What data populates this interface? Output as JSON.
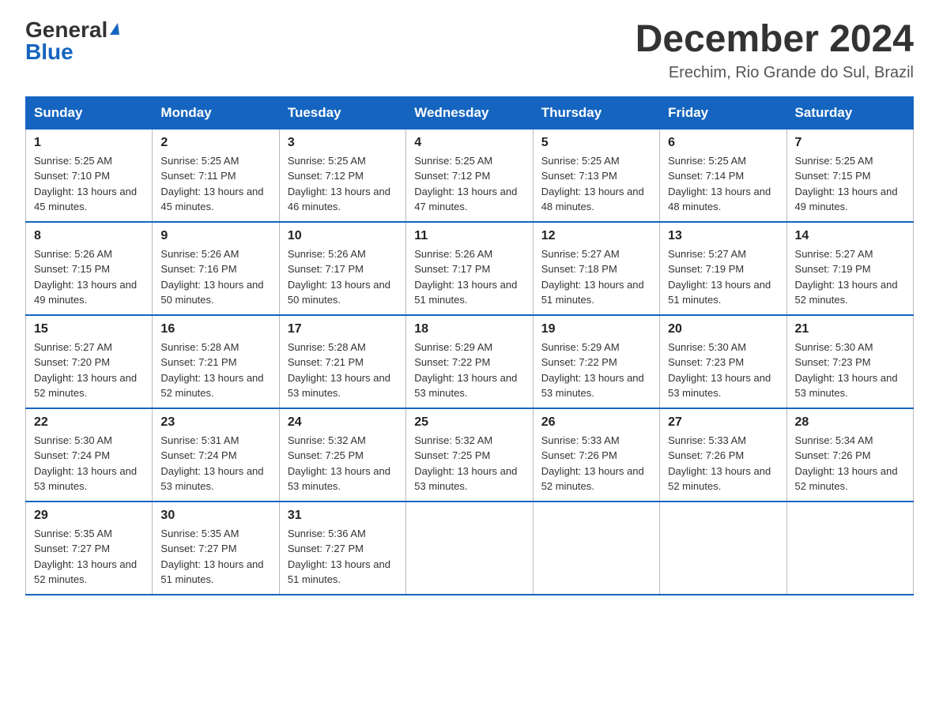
{
  "header": {
    "logo": {
      "general": "General",
      "blue": "Blue",
      "triangle": "▲"
    },
    "title": "December 2024",
    "location": "Erechim, Rio Grande do Sul, Brazil"
  },
  "calendar": {
    "days_of_week": [
      "Sunday",
      "Monday",
      "Tuesday",
      "Wednesday",
      "Thursday",
      "Friday",
      "Saturday"
    ],
    "weeks": [
      [
        {
          "day": "1",
          "sunrise": "5:25 AM",
          "sunset": "7:10 PM",
          "daylight": "13 hours and 45 minutes."
        },
        {
          "day": "2",
          "sunrise": "5:25 AM",
          "sunset": "7:11 PM",
          "daylight": "13 hours and 45 minutes."
        },
        {
          "day": "3",
          "sunrise": "5:25 AM",
          "sunset": "7:12 PM",
          "daylight": "13 hours and 46 minutes."
        },
        {
          "day": "4",
          "sunrise": "5:25 AM",
          "sunset": "7:12 PM",
          "daylight": "13 hours and 47 minutes."
        },
        {
          "day": "5",
          "sunrise": "5:25 AM",
          "sunset": "7:13 PM",
          "daylight": "13 hours and 48 minutes."
        },
        {
          "day": "6",
          "sunrise": "5:25 AM",
          "sunset": "7:14 PM",
          "daylight": "13 hours and 48 minutes."
        },
        {
          "day": "7",
          "sunrise": "5:25 AM",
          "sunset": "7:15 PM",
          "daylight": "13 hours and 49 minutes."
        }
      ],
      [
        {
          "day": "8",
          "sunrise": "5:26 AM",
          "sunset": "7:15 PM",
          "daylight": "13 hours and 49 minutes."
        },
        {
          "day": "9",
          "sunrise": "5:26 AM",
          "sunset": "7:16 PM",
          "daylight": "13 hours and 50 minutes."
        },
        {
          "day": "10",
          "sunrise": "5:26 AM",
          "sunset": "7:17 PM",
          "daylight": "13 hours and 50 minutes."
        },
        {
          "day": "11",
          "sunrise": "5:26 AM",
          "sunset": "7:17 PM",
          "daylight": "13 hours and 51 minutes."
        },
        {
          "day": "12",
          "sunrise": "5:27 AM",
          "sunset": "7:18 PM",
          "daylight": "13 hours and 51 minutes."
        },
        {
          "day": "13",
          "sunrise": "5:27 AM",
          "sunset": "7:19 PM",
          "daylight": "13 hours and 51 minutes."
        },
        {
          "day": "14",
          "sunrise": "5:27 AM",
          "sunset": "7:19 PM",
          "daylight": "13 hours and 52 minutes."
        }
      ],
      [
        {
          "day": "15",
          "sunrise": "5:27 AM",
          "sunset": "7:20 PM",
          "daylight": "13 hours and 52 minutes."
        },
        {
          "day": "16",
          "sunrise": "5:28 AM",
          "sunset": "7:21 PM",
          "daylight": "13 hours and 52 minutes."
        },
        {
          "day": "17",
          "sunrise": "5:28 AM",
          "sunset": "7:21 PM",
          "daylight": "13 hours and 53 minutes."
        },
        {
          "day": "18",
          "sunrise": "5:29 AM",
          "sunset": "7:22 PM",
          "daylight": "13 hours and 53 minutes."
        },
        {
          "day": "19",
          "sunrise": "5:29 AM",
          "sunset": "7:22 PM",
          "daylight": "13 hours and 53 minutes."
        },
        {
          "day": "20",
          "sunrise": "5:30 AM",
          "sunset": "7:23 PM",
          "daylight": "13 hours and 53 minutes."
        },
        {
          "day": "21",
          "sunrise": "5:30 AM",
          "sunset": "7:23 PM",
          "daylight": "13 hours and 53 minutes."
        }
      ],
      [
        {
          "day": "22",
          "sunrise": "5:30 AM",
          "sunset": "7:24 PM",
          "daylight": "13 hours and 53 minutes."
        },
        {
          "day": "23",
          "sunrise": "5:31 AM",
          "sunset": "7:24 PM",
          "daylight": "13 hours and 53 minutes."
        },
        {
          "day": "24",
          "sunrise": "5:32 AM",
          "sunset": "7:25 PM",
          "daylight": "13 hours and 53 minutes."
        },
        {
          "day": "25",
          "sunrise": "5:32 AM",
          "sunset": "7:25 PM",
          "daylight": "13 hours and 53 minutes."
        },
        {
          "day": "26",
          "sunrise": "5:33 AM",
          "sunset": "7:26 PM",
          "daylight": "13 hours and 52 minutes."
        },
        {
          "day": "27",
          "sunrise": "5:33 AM",
          "sunset": "7:26 PM",
          "daylight": "13 hours and 52 minutes."
        },
        {
          "day": "28",
          "sunrise": "5:34 AM",
          "sunset": "7:26 PM",
          "daylight": "13 hours and 52 minutes."
        }
      ],
      [
        {
          "day": "29",
          "sunrise": "5:35 AM",
          "sunset": "7:27 PM",
          "daylight": "13 hours and 52 minutes."
        },
        {
          "day": "30",
          "sunrise": "5:35 AM",
          "sunset": "7:27 PM",
          "daylight": "13 hours and 51 minutes."
        },
        {
          "day": "31",
          "sunrise": "5:36 AM",
          "sunset": "7:27 PM",
          "daylight": "13 hours and 51 minutes."
        },
        null,
        null,
        null,
        null
      ]
    ]
  },
  "labels": {
    "sunrise_prefix": "Sunrise: ",
    "sunset_prefix": "Sunset: ",
    "daylight_prefix": "Daylight: "
  }
}
